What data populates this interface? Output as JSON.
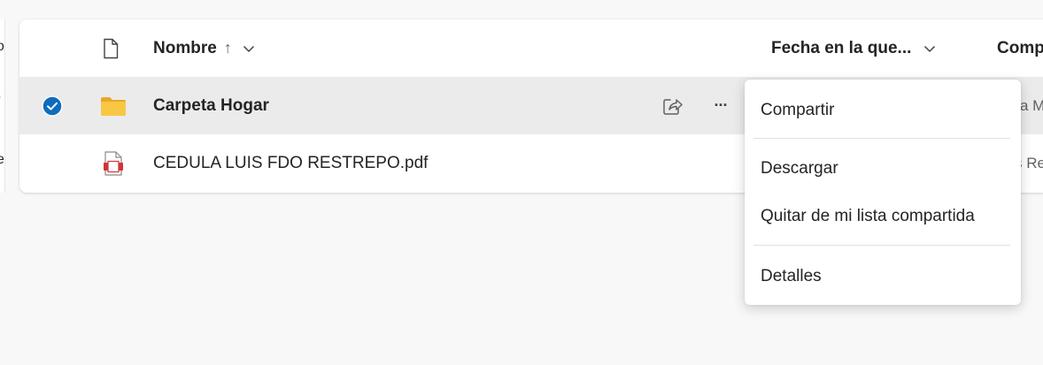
{
  "left_panel": {
    "row_header_fragment": "o",
    "row1_fragment": "/",
    "row2_fragment": "e"
  },
  "header": {
    "name_label": "Nombre",
    "sort_arrow": "↑",
    "date_label": "Fecha en la que...",
    "shared_label": "Comp"
  },
  "rows": [
    {
      "name": "Carpeta Hogar",
      "type": "folder",
      "selected": true,
      "shared_by_fragment": "a M"
    },
    {
      "name": "CEDULA LUIS FDO RESTREPO.pdf",
      "type": "pdf",
      "selected": false,
      "shared_by_fragment": "s Re"
    }
  ],
  "row_actions": {
    "more_label": "···"
  },
  "context_menu": {
    "items": [
      "Compartir",
      "Descargar",
      "Quitar de mi lista compartida",
      "Detalles"
    ]
  },
  "colors": {
    "accent": "#0f6cbd",
    "folder": "#f8c744",
    "pdf": "#d13438",
    "selected_row": "#ebebeb"
  }
}
